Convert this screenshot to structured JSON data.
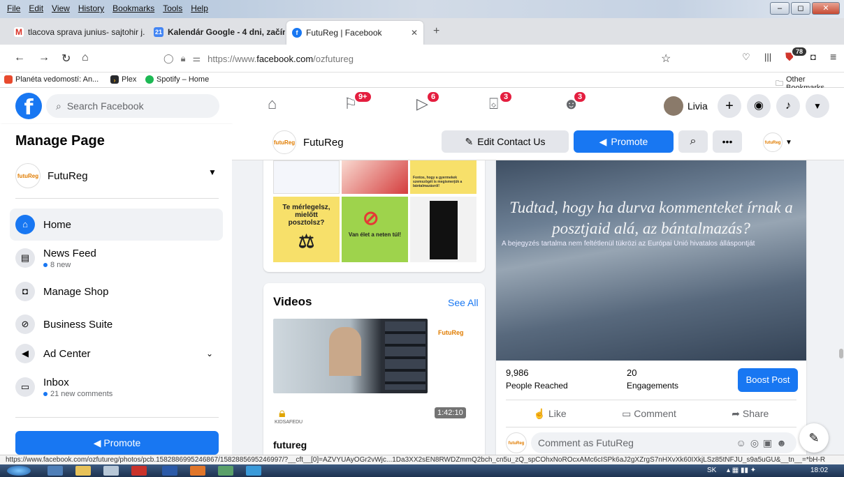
{
  "browser": {
    "menu": [
      "File",
      "Edit",
      "View",
      "History",
      "Bookmarks",
      "Tools",
      "Help"
    ],
    "tabs": [
      {
        "label": "tlacova sprava junius- sajtohir j..."
      },
      {
        "label": "Kalendár Google - 4 dni, začín..."
      },
      {
        "label": "FutuReg | Facebook"
      }
    ],
    "url_prefix": "https://www.",
    "url_domain": "facebook.com",
    "url_path": "/ozfutureg",
    "extension_badge": "78",
    "bookmarks": [
      "Planéta vedomostí: An...",
      "Plex",
      "Spotify – Home"
    ],
    "other_bookmarks": "Other Bookmarks",
    "status_url": "https://www.facebook.com/ozfutureg/photos/pcb.1582886995246867/1582885695246997/?__cft__[0]=AZVYUAyOGr2vWjc...1Da3XX2sEN8RWDZmmQ2bch_cn5u_zQ_spCOhxNoROcxAMc6cISPk6aJ2gXZrgS7nHXvXk60IXkjLSz85tNFJU_s9a5uGU&__tn__=*bH-R"
  },
  "fb": {
    "search_placeholder": "Search Facebook",
    "badges": {
      "flag": "9+",
      "watch": "6",
      "market": "3",
      "groups": "3"
    },
    "user_name": "Livia"
  },
  "left": {
    "title": "Manage Page",
    "page_name": "FutuReg",
    "items": [
      {
        "label": "Home"
      },
      {
        "label": "News Feed",
        "sub": "8 new"
      },
      {
        "label": "Manage Shop"
      },
      {
        "label": "Business Suite"
      },
      {
        "label": "Ad Center"
      },
      {
        "label": "Inbox",
        "sub": "21 new comments"
      }
    ],
    "promote": "Promote"
  },
  "page_header": {
    "name": "FutuReg",
    "edit_contact": "Edit Contact Us",
    "promote": "Promote"
  },
  "photos": {
    "caption1": "Te mérlegelsz, mielőtt posztolsz?",
    "caption2": "Van élet a neten túl!",
    "caption3": "Fontos, hogy a gyermekek szemszögét is megismerjük a bántalmazásról!",
    "brand": "FutuReg"
  },
  "videos": {
    "title": "Videos",
    "see_all": "See All",
    "duration": "1:42:10",
    "kids_label": "KIDSAFEDU",
    "channel": "futureg"
  },
  "post": {
    "headline": "Tudtad, hogy ha durva kommenteket írnak a posztjaid alá, az bántalmazás?",
    "disclaimer": "A bejegyzés tartalma nem feltétlenül tükrözi az Európai Unió hivatalos álláspontját",
    "reach_value": "9,986",
    "reach_label": "People Reached",
    "eng_value": "20",
    "eng_label": "Engagements",
    "boost": "Boost Post",
    "like": "Like",
    "comment": "Comment",
    "share": "Share",
    "comment_placeholder": "Comment as FutuReg"
  },
  "taskbar": {
    "lang": "SK",
    "time": "18:02"
  }
}
